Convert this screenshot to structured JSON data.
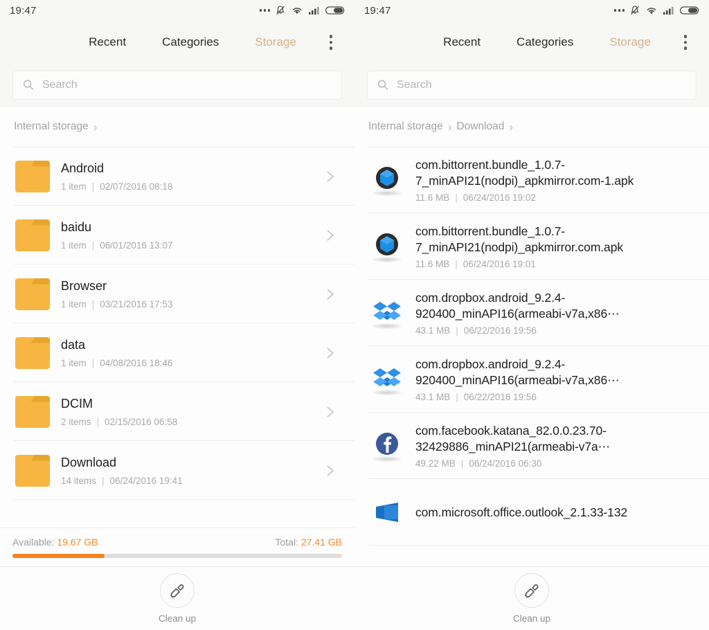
{
  "panels": [
    {
      "status": {
        "time": "19:47",
        "icons": [
          "ellipsis-icon",
          "notifications-muted-icon",
          "wifi-icon",
          "signal-icon",
          "battery-icon"
        ]
      },
      "tabs": [
        {
          "label": "Recent",
          "active": false
        },
        {
          "label": "Categories",
          "active": false
        },
        {
          "label": "Storage",
          "active": true
        }
      ],
      "overflow_menu": "more-options",
      "search": {
        "placeholder": "Search",
        "value": ""
      },
      "breadcrumb": [
        "Internal storage"
      ],
      "list_type": "folders",
      "items": [
        {
          "name": "Android",
          "count": "1 item",
          "date": "02/07/2016 08:18",
          "icon": "folder-icon"
        },
        {
          "name": "baidu",
          "count": "1 item",
          "date": "06/01/2016 13:07",
          "icon": "folder-icon"
        },
        {
          "name": "Browser",
          "count": "1 item",
          "date": "03/21/2016 17:53",
          "icon": "folder-icon"
        },
        {
          "name": "data",
          "count": "1 item",
          "date": "04/08/2016 18:46",
          "icon": "folder-icon"
        },
        {
          "name": "DCIM",
          "count": "2 items",
          "date": "02/15/2016 06:58",
          "icon": "folder-icon"
        },
        {
          "name": "Download",
          "count": "14 items",
          "date": "06/24/2016 19:41",
          "icon": "folder-icon"
        }
      ],
      "storage": {
        "available_label": "Available:",
        "available_value": "19.67 GB",
        "total_label": "Total:",
        "total_value": "27.41 GB",
        "used_percent": 28
      },
      "bottom": {
        "label": "Clean up",
        "icon": "brush-icon"
      }
    },
    {
      "status": {
        "time": "19:47",
        "icons": [
          "ellipsis-icon",
          "notifications-muted-icon",
          "wifi-icon",
          "signal-icon",
          "battery-icon"
        ]
      },
      "tabs": [
        {
          "label": "Recent",
          "active": false
        },
        {
          "label": "Categories",
          "active": false
        },
        {
          "label": "Storage",
          "active": true
        }
      ],
      "overflow_menu": "more-options",
      "search": {
        "placeholder": "Search",
        "value": ""
      },
      "breadcrumb": [
        "Internal storage",
        "Download"
      ],
      "list_type": "files",
      "items": [
        {
          "name": "com.bittorrent.bundle_1.0.7-7_minAPI21(nodpi)_apkmirror.com-1.apk",
          "size": "11.6 MB",
          "date": "06/24/2016 19:02",
          "icon": "bittorrent-icon"
        },
        {
          "name": "com.bittorrent.bundle_1.0.7-7_minAPI21(nodpi)_apkmirror.com.apk",
          "size": "11.6 MB",
          "date": "06/24/2016 19:01",
          "icon": "bittorrent-icon"
        },
        {
          "name": "com.dropbox.android_9.2.4-920400_minAPI16(armeabi-v7a,x86⋯",
          "size": "43.1 MB",
          "date": "06/22/2016 19:56",
          "icon": "dropbox-icon"
        },
        {
          "name": "com.dropbox.android_9.2.4-920400_minAPI16(armeabi-v7a,x86⋯",
          "size": "43.1 MB",
          "date": "06/22/2016 19:56",
          "icon": "dropbox-icon"
        },
        {
          "name": "com.facebook.katana_82.0.0.23.70-32429886_minAPI21(armeabi-v7a⋯",
          "size": "49.22 MB",
          "date": "06/24/2016 06:30",
          "icon": "facebook-icon"
        },
        {
          "name": "com.microsoft.office.outlook_2.1.33-132",
          "size": "",
          "date": "",
          "icon": "outlook-icon",
          "clipped": true
        }
      ],
      "bottom": {
        "label": "Clean up",
        "icon": "brush-icon"
      }
    }
  ],
  "colors": {
    "accent_orange": "#f58220",
    "tab_active": "#d6b28a",
    "folder": "#f7b541"
  }
}
